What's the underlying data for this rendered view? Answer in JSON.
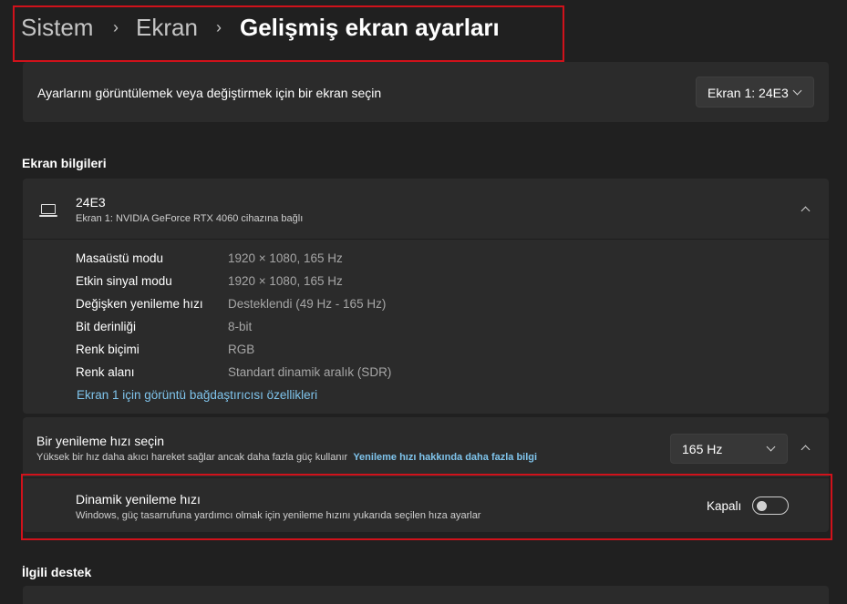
{
  "breadcrumb": {
    "items": [
      "Sistem",
      "Ekran"
    ],
    "current": "Gelişmiş ekran ayarları",
    "separator": "›"
  },
  "display_select": {
    "label": "Ayarlarını görüntülemek veya değiştirmek için bir ekran seçin",
    "value": "Ekran 1: 24E3"
  },
  "display_info": {
    "heading": "Ekran bilgileri",
    "monitor_name": "24E3",
    "monitor_desc": "Ekran 1: NVIDIA GeForce RTX 4060 cihazına bağlı",
    "properties": [
      {
        "key": "Masaüstü modu",
        "value": "1920 × 1080, 165 Hz"
      },
      {
        "key": "Etkin sinyal modu",
        "value": "1920 × 1080, 165 Hz"
      },
      {
        "key": "Değişken yenileme hızı",
        "value": "Desteklendi (49 Hz - 165 Hz)"
      },
      {
        "key": "Bit derinliği",
        "value": "8-bit"
      },
      {
        "key": "Renk biçimi",
        "value": "RGB"
      },
      {
        "key": "Renk alanı",
        "value": "Standart dinamik aralık (SDR)"
      }
    ],
    "adapter_link": "Ekran 1 için görüntü bağdaştırıcısı özellikleri"
  },
  "refresh_rate": {
    "title": "Bir yenileme hızı seçin",
    "description": "Yüksek bir hız daha akıcı hareket sağlar ancak daha fazla güç kullanır",
    "learn_more": "Yenileme hızı hakkında daha fazla bilgi",
    "value": "165 Hz"
  },
  "dynamic_refresh": {
    "title": "Dinamik yenileme hızı",
    "description": "Windows, güç tasarrufuna yardımcı olmak için yenileme hızını yukarıda seçilen hıza ayarlar",
    "state_label": "Kapalı",
    "enabled": false
  },
  "related": {
    "heading": "İlgili destek"
  },
  "colors": {
    "background": "#202020",
    "card": "#2b2b2b",
    "accent_link": "#7fc4ec",
    "highlight": "#d0121b"
  }
}
